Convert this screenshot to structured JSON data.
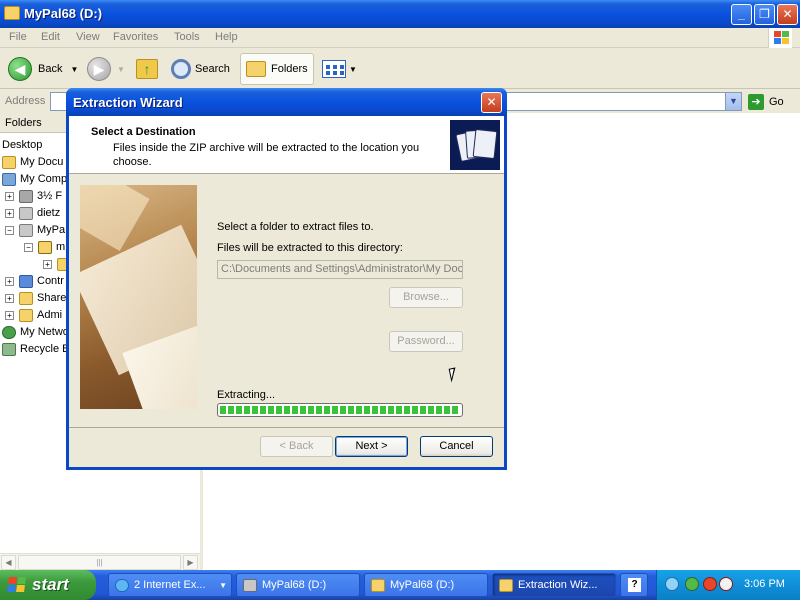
{
  "window": {
    "title": "MyPal68 (D:)",
    "caption": {
      "minimize": "_",
      "maximize": "❐",
      "close": "✕"
    }
  },
  "menu": [
    "File",
    "Edit",
    "View",
    "Favorites",
    "Tools",
    "Help"
  ],
  "toolbar": {
    "back_label": "Back",
    "search_label": "Search",
    "folders_label": "Folders"
  },
  "addressbar": {
    "label": "Address",
    "value": "",
    "go_label": "Go"
  },
  "folders_pane": {
    "title": "Folders",
    "items": [
      "Desktop",
      "My Docu",
      "My Comp",
      "3½ F",
      "dietz",
      "MyPa",
      "m",
      "",
      "Contr",
      "Share",
      "Admi",
      "My Netwo",
      "Recycle B"
    ]
  },
  "dialog": {
    "title": "Extraction Wizard",
    "heading": "Select a Destination",
    "subheading": "Files inside the ZIP archive will be extracted to the location you choose.",
    "select_label": "Select a folder to extract files to.",
    "dir_label": "Files will be extracted to this directory:",
    "path_value": "C:\\Documents and Settings\\Administrator\\My Docu",
    "browse_label": "Browse...",
    "password_label": "Password...",
    "progress_label": "Extracting...",
    "progress": 1.0,
    "back_label": "< Back",
    "next_label": "Next >",
    "cancel_label": "Cancel"
  },
  "taskbar": {
    "start_label": "start",
    "tasks": [
      {
        "label": "2 Internet Ex..."
      },
      {
        "label": "MyPal68 (D:)"
      },
      {
        "label": "MyPal68 (D:)"
      },
      {
        "label": "Extraction Wiz..."
      }
    ],
    "help_label": "?",
    "clock": "3:06 PM"
  },
  "colors": {
    "titlebar": "#0a52e0",
    "start_green": "#3c9a3c",
    "tray_blue": "#0f8fd8",
    "progress_green": "#3ac23a"
  }
}
